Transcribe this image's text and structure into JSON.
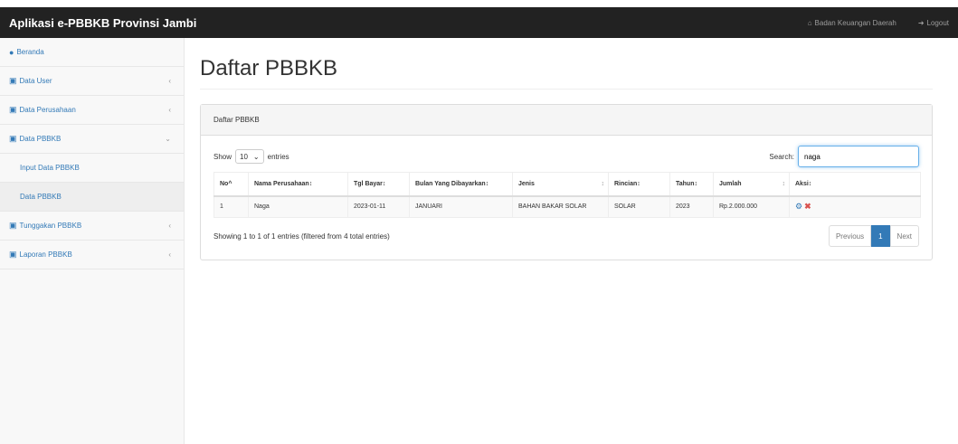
{
  "app": {
    "title": "Aplikasi e-PBBKB Provinsi Jambi"
  },
  "topbar": {
    "org_label": "Badan Keuangan Daerah",
    "logout_label": "Logout"
  },
  "sidebar": {
    "items": [
      {
        "label": "Beranda"
      },
      {
        "label": "Data User"
      },
      {
        "label": "Data Perusahaan"
      },
      {
        "label": "Data PBBKB"
      },
      {
        "label": "Input Data PBBKB"
      },
      {
        "label": "Data PBBKB"
      },
      {
        "label": "Tunggakan PBBKB"
      },
      {
        "label": "Laporan PBBKB"
      }
    ]
  },
  "main": {
    "title": "Daftar PBBKB",
    "panel_heading": "Daftar PBBKB",
    "show_label": "Show",
    "length_value": "10",
    "entries_label": "entries",
    "search_label": "Search:",
    "search_value": "naga",
    "columns": [
      "No",
      "Nama Perusahaan",
      "Tgl Bayar",
      "Bulan Yang Dibayarkan",
      "Jenis",
      "Rincian",
      "Tahun",
      "Jumlah",
      "Aksi"
    ],
    "rows": [
      {
        "no": "1",
        "nama": "Naga",
        "tgl": "2023-01-11",
        "bulan": "JANUARI",
        "jenis": "BAHAN BAKAR SOLAR",
        "rincian": "SOLAR",
        "tahun": "2023",
        "jumlah": "Rp.2.000.000"
      }
    ],
    "info": "Showing 1 to 1 of 1 entries (filtered from 4 total entries)",
    "pager": {
      "previous": "Previous",
      "page": "1",
      "next": "Next"
    }
  }
}
